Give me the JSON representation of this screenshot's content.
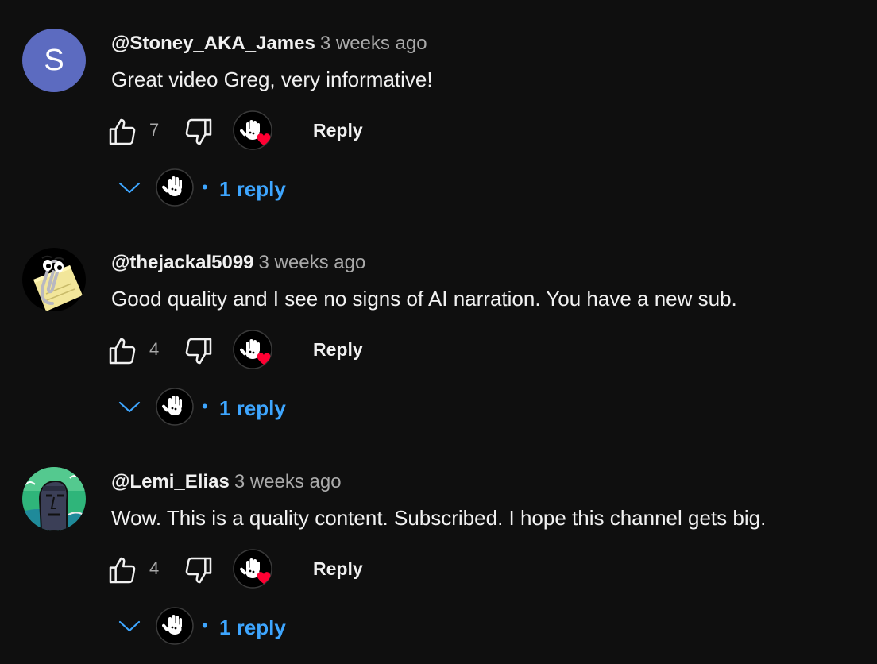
{
  "comments": [
    {
      "author": "@Stoney_AKA_James",
      "timestamp": "3 weeks ago",
      "text": "Great video Greg, very informative!",
      "likes": "7",
      "avatar_letter": "S",
      "avatar_color": "#5c6bc0",
      "reply_label": "Reply",
      "dot": "•",
      "replies_label": "1 reply"
    },
    {
      "author": "@thejackal5099",
      "timestamp": "3 weeks ago",
      "text": "Good quality and I see no signs of AI narration. You have a new sub.",
      "likes": "4",
      "reply_label": "Reply",
      "dot": "•",
      "replies_label": "1 reply"
    },
    {
      "author": "@Lemi_Elias",
      "timestamp": "3 weeks ago",
      "text": "Wow. This is a quality content. Subscribed. I hope this channel gets big.",
      "likes": "4",
      "reply_label": "Reply",
      "dot": "•",
      "replies_label": "1 reply"
    }
  ],
  "icons": {
    "like": "thumbs-up-icon",
    "dislike": "thumbs-down-icon",
    "creator_heart": "creator-heart-icon",
    "chevron": "chevron-down-icon"
  },
  "colors": {
    "background": "#0f0f0f",
    "primary_text": "#f1f1f1",
    "secondary_text": "#aaaaaa",
    "link_blue": "#3ea6ff",
    "heart_red": "#ff0033"
  }
}
